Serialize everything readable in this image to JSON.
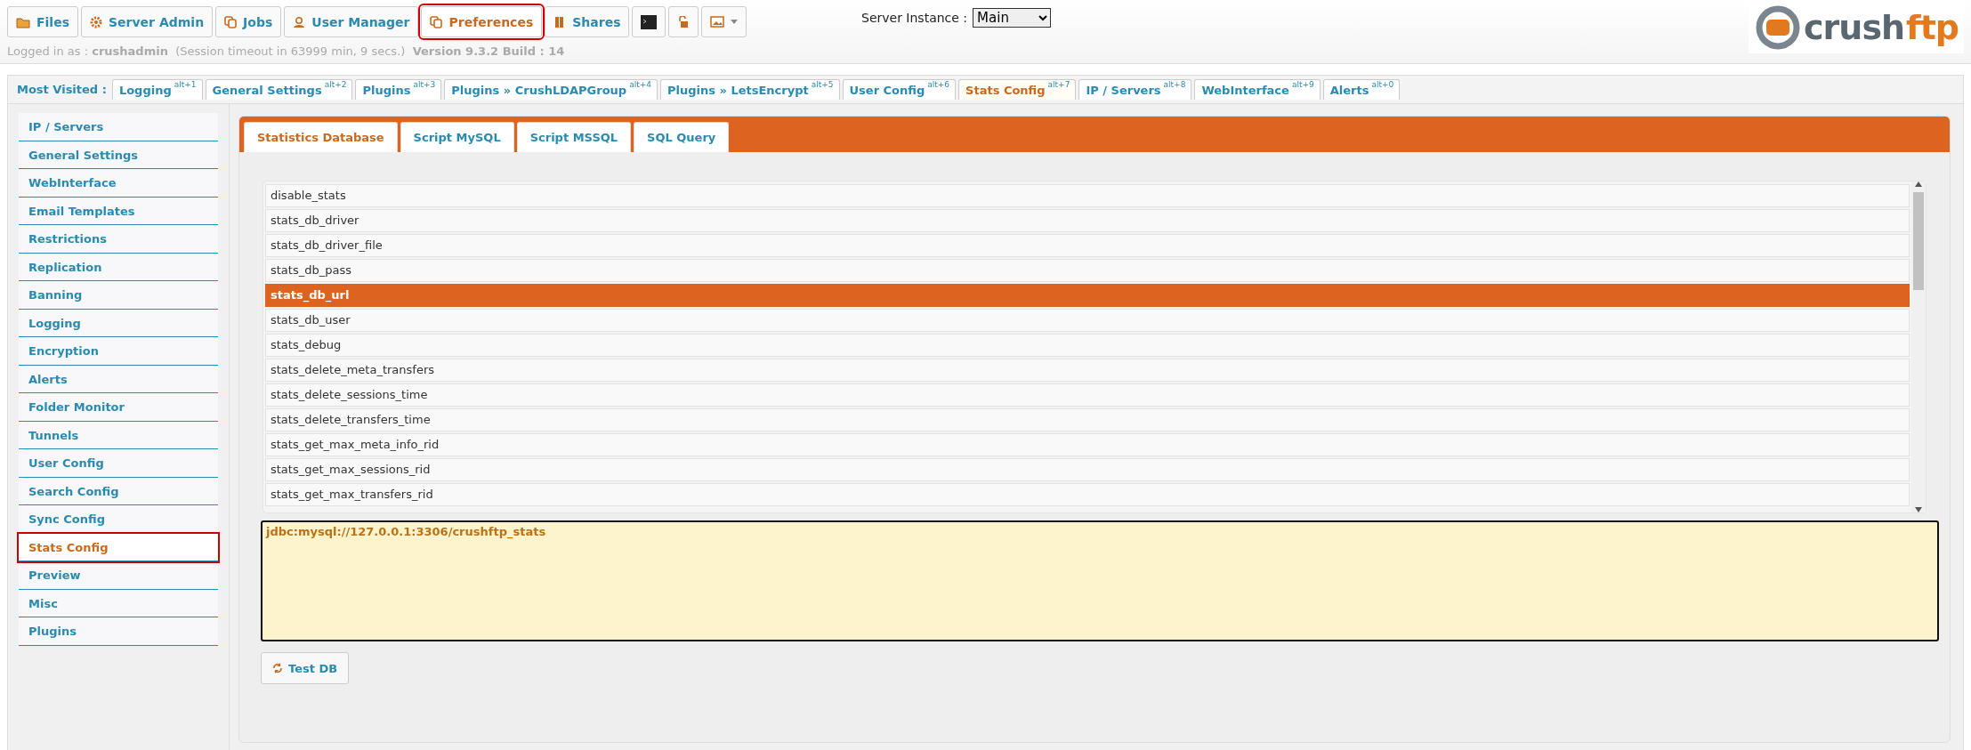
{
  "toolbar": {
    "buttons": [
      {
        "label": "Files",
        "selected": false
      },
      {
        "label": "Server Admin",
        "selected": false
      },
      {
        "label": "Jobs",
        "selected": false
      },
      {
        "label": "User Manager",
        "selected": false
      },
      {
        "label": "Preferences",
        "selected": true
      },
      {
        "label": "Shares",
        "selected": false
      }
    ]
  },
  "server_instance": {
    "label": "Server Instance :",
    "value": "Main"
  },
  "session": {
    "label": "Logged in as :",
    "user": "crushadmin",
    "timeout": "(Session timeout in 63999 min, 9 secs.)",
    "version": "Version 9.3.2 Build : 14"
  },
  "logo": {
    "word_1": "crush",
    "word_2": "ftp"
  },
  "most_visited": {
    "label": "Most Visited :",
    "items": [
      {
        "label": "Logging",
        "shortcut": "alt+1",
        "selected": false
      },
      {
        "label": "General Settings",
        "shortcut": "alt+2",
        "selected": false
      },
      {
        "label": "Plugins",
        "shortcut": "alt+3",
        "selected": false
      },
      {
        "label": "Plugins » CrushLDAPGroup",
        "shortcut": "alt+4",
        "selected": false
      },
      {
        "label": "Plugins » LetsEncrypt",
        "shortcut": "alt+5",
        "selected": false
      },
      {
        "label": "User Config",
        "shortcut": "alt+6",
        "selected": false
      },
      {
        "label": "Stats Config",
        "shortcut": "alt+7",
        "selected": true
      },
      {
        "label": "IP / Servers",
        "shortcut": "alt+8",
        "selected": false
      },
      {
        "label": "WebInterface",
        "shortcut": "alt+9",
        "selected": false
      },
      {
        "label": "Alerts",
        "shortcut": "alt+0",
        "selected": false
      }
    ]
  },
  "sidebar": {
    "items": [
      {
        "label": "IP / Servers",
        "selected": false
      },
      {
        "label": "General Settings",
        "selected": false
      },
      {
        "label": "WebInterface",
        "selected": false
      },
      {
        "label": "Email Templates",
        "selected": false
      },
      {
        "label": "Restrictions",
        "selected": false
      },
      {
        "label": "Replication",
        "selected": false
      },
      {
        "label": "Banning",
        "selected": false
      },
      {
        "label": "Logging",
        "selected": false
      },
      {
        "label": "Encryption",
        "selected": false
      },
      {
        "label": "Alerts",
        "selected": false
      },
      {
        "label": "Folder Monitor",
        "selected": false
      },
      {
        "label": "Tunnels",
        "selected": false
      },
      {
        "label": "User Config",
        "selected": false
      },
      {
        "label": "Search Config",
        "selected": false
      },
      {
        "label": "Sync Config",
        "selected": false
      },
      {
        "label": "Stats Config",
        "selected": true
      },
      {
        "label": "Preview",
        "selected": false
      },
      {
        "label": "Misc",
        "selected": false
      },
      {
        "label": "Plugins",
        "selected": false
      }
    ]
  },
  "tabs": [
    {
      "label": "Statistics Database",
      "selected": true
    },
    {
      "label": "Script MySQL",
      "selected": false
    },
    {
      "label": "Script MSSQL",
      "selected": false
    },
    {
      "label": "SQL Query",
      "selected": false
    }
  ],
  "settings_list": {
    "items": [
      {
        "name": "disable_stats",
        "selected": false
      },
      {
        "name": "stats_db_driver",
        "selected": false
      },
      {
        "name": "stats_db_driver_file",
        "selected": false
      },
      {
        "name": "stats_db_pass",
        "selected": false
      },
      {
        "name": "stats_db_url",
        "selected": true
      },
      {
        "name": "stats_db_user",
        "selected": false
      },
      {
        "name": "stats_debug",
        "selected": false
      },
      {
        "name": "stats_delete_meta_transfers",
        "selected": false
      },
      {
        "name": "stats_delete_sessions_time",
        "selected": false
      },
      {
        "name": "stats_delete_transfers_time",
        "selected": false
      },
      {
        "name": "stats_get_max_meta_info_rid",
        "selected": false
      },
      {
        "name": "stats_get_max_sessions_rid",
        "selected": false
      },
      {
        "name": "stats_get_max_transfers_rid",
        "selected": false
      }
    ]
  },
  "value_field": {
    "value": "jdbc:mysql://127.0.0.1:3306/crushftp_stats"
  },
  "test_button": {
    "label": "Test DB"
  }
}
